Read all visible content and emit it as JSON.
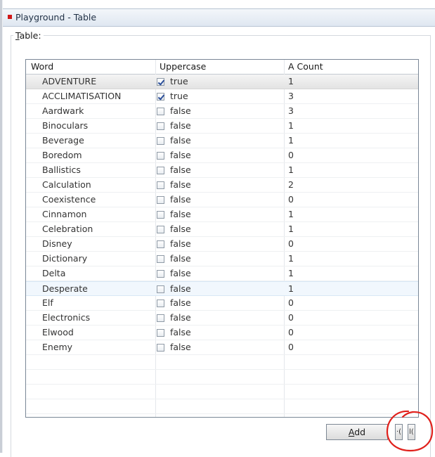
{
  "window": {
    "title": "Playground - Table",
    "accent_color": "#d01818"
  },
  "group": {
    "label_mnemonic": "T",
    "label_rest": "able:"
  },
  "table": {
    "columns": [
      "Word",
      "Uppercase",
      "A Count"
    ],
    "rows": [
      {
        "word": "ADVENTURE",
        "checked": true,
        "uppercase": "true",
        "count": "1"
      },
      {
        "word": "ACCLIMATISATION",
        "checked": true,
        "uppercase": "true",
        "count": "3"
      },
      {
        "word": "Aardwark",
        "checked": false,
        "uppercase": "false",
        "count": "3"
      },
      {
        "word": "Binoculars",
        "checked": false,
        "uppercase": "false",
        "count": "1"
      },
      {
        "word": "Beverage",
        "checked": false,
        "uppercase": "false",
        "count": "1"
      },
      {
        "word": "Boredom",
        "checked": false,
        "uppercase": "false",
        "count": "0"
      },
      {
        "word": "Ballistics",
        "checked": false,
        "uppercase": "false",
        "count": "1"
      },
      {
        "word": "Calculation",
        "checked": false,
        "uppercase": "false",
        "count": "2"
      },
      {
        "word": "Coexistence",
        "checked": false,
        "uppercase": "false",
        "count": "0"
      },
      {
        "word": "Cinnamon",
        "checked": false,
        "uppercase": "false",
        "count": "1"
      },
      {
        "word": "Celebration",
        "checked": false,
        "uppercase": "false",
        "count": "1"
      },
      {
        "word": "Disney",
        "checked": false,
        "uppercase": "false",
        "count": "0"
      },
      {
        "word": "Dictionary",
        "checked": false,
        "uppercase": "false",
        "count": "1"
      },
      {
        "word": "Delta",
        "checked": false,
        "uppercase": "false",
        "count": "1"
      },
      {
        "word": "Desperate",
        "checked": false,
        "uppercase": "false",
        "count": "1"
      },
      {
        "word": "Elf",
        "checked": false,
        "uppercase": "false",
        "count": "0"
      },
      {
        "word": "Electronics",
        "checked": false,
        "uppercase": "false",
        "count": "0"
      },
      {
        "word": "Elwood",
        "checked": false,
        "uppercase": "false",
        "count": "0"
      },
      {
        "word": "Enemy",
        "checked": false,
        "uppercase": "false",
        "count": "0"
      }
    ],
    "selected_row": "ADVENTURE",
    "hover_row": "Desperate"
  },
  "buttons": {
    "add_mnemonic": "A",
    "add_rest": "dd",
    "nav_prev": "·(",
    "nav_next": "l("
  },
  "annotation": {
    "color": "#e0201b"
  }
}
